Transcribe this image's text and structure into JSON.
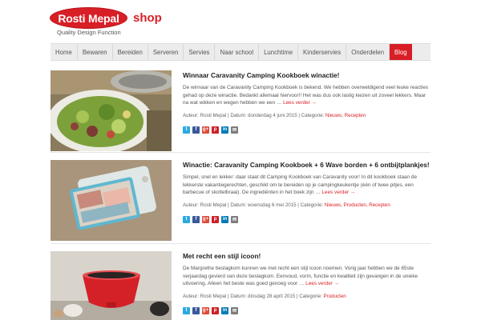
{
  "brand": {
    "logo_text": "Rosti Mepal",
    "shop_label": "shop",
    "tagline": "Quality Design Function"
  },
  "nav": {
    "items": [
      {
        "label": "Home",
        "active": false
      },
      {
        "label": "Bewaren",
        "active": false
      },
      {
        "label": "Bereiden",
        "active": false
      },
      {
        "label": "Serveren",
        "active": false
      },
      {
        "label": "Servies",
        "active": false
      },
      {
        "label": "Naar school",
        "active": false
      },
      {
        "label": "Lunchtime",
        "active": false
      },
      {
        "label": "Kinderservies",
        "active": false
      },
      {
        "label": "Onderdelen",
        "active": false
      },
      {
        "label": "Blog",
        "active": true
      }
    ]
  },
  "share_icons": [
    {
      "icon": "twitter-icon",
      "glyph": "t",
      "color": "#2ba9e1"
    },
    {
      "icon": "facebook-icon",
      "glyph": "f",
      "color": "#3b5998"
    },
    {
      "icon": "googleplus-icon",
      "glyph": "g+",
      "color": "#dd4b39"
    },
    {
      "icon": "pinterest-icon",
      "glyph": "p",
      "color": "#cb2027"
    },
    {
      "icon": "linkedin-icon",
      "glyph": "in",
      "color": "#007bb6"
    },
    {
      "icon": "email-icon",
      "glyph": "✉",
      "color": "#7d7d7d"
    }
  ],
  "posts": [
    {
      "title": "Winnaar Caravanity Camping Kookboek winactie!",
      "excerpt": "De winnaar van de Caravanity Camping Kookboek is bekend. We hebben overweldigend veel leuke reacties gehad op deze winactie. Bedankt allemaal hiervoor!! Het was dus ook lastig kiezen uit zoveel lekkers. Maar na wat wikken en wegen hebben we een …",
      "read_more": "Lees verder →",
      "meta_prefix": "Auteur: Rosti Mepal | Datum: donderdag 4 juni 2015 | Categorie: ",
      "categories": "Nieuws, Recepten"
    },
    {
      "title": "Winactie: Caravanity Camping Kookboek + 6 Wave borden + 6 ontbijtplankjes!",
      "excerpt": "Simpel, snel en lekker: daar staat dit Camping Kookboek van Caravanity voor! In dit kookboek staan de lekkerste vakantiegerechten, geschikt om te bereiden op je campingkeukentje (één of twee pitjes, een barbecue of skottelbraai). De ingrediënten in het boek zijn …",
      "read_more": "Lees verder →",
      "meta_prefix": "Auteur: Rosti Mepal | Datum: woensdag 6 mei 2015 | Categorie: ",
      "categories": "Nieuws, Producten, Recepten"
    },
    {
      "title": "Met recht een stijl icoon!",
      "excerpt": "De Margrethe beslagkom kunnen we met recht een stijl icoon noemen. Vorig jaar hebben we de 65ste verjaardag gevierd van deze beslagkom. Eenvoud, vorm, functie en kwaliteit zijn gevangen in de unieke uitvoering. Alleen het beste was goed genoeg voor …",
      "read_more": "Lees verder →",
      "meta_prefix": "Auteur: Rosti Mepal | Datum: dinsdag 28 april 2015 | Categorie: ",
      "categories": "Producten"
    }
  ]
}
